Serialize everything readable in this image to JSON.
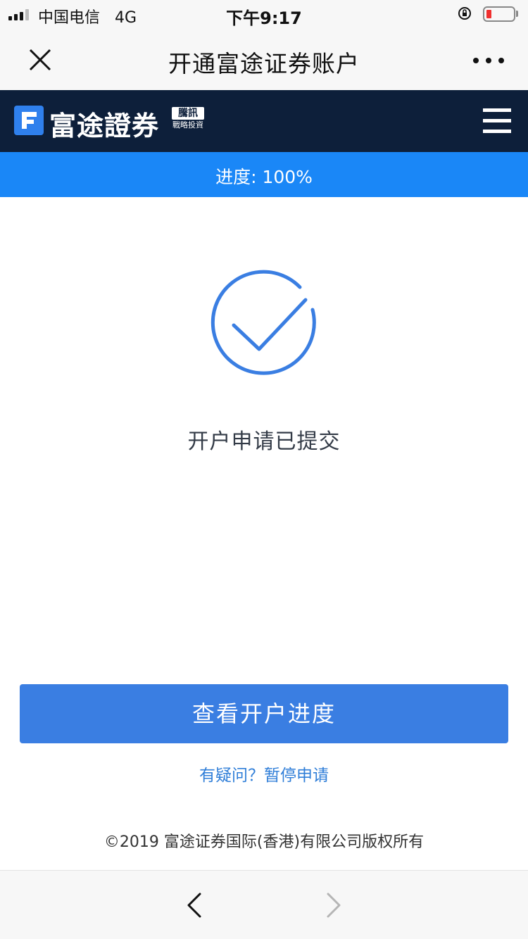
{
  "status_bar": {
    "carrier": "中国电信",
    "network": "4G",
    "time": "下午9:17",
    "battery_color": "#f0302f"
  },
  "nav": {
    "title": "开通富途证券账户",
    "close_icon": "close-icon",
    "more_icon": "more-icon"
  },
  "brand": {
    "name": "富途證券",
    "partner_tag": "騰訊",
    "partner_sub": "戰略投資",
    "logo_color": "#2f80ed",
    "background": "#0d1f3a"
  },
  "progress": {
    "label": "进度: 100%",
    "value": 1.0,
    "color": "#1a87f7"
  },
  "main": {
    "icon": "check-circle-icon",
    "message": "开户申请已提交",
    "primary_button": "查看开户进度",
    "help_link": "有疑问？暂停申请",
    "copyright": "©2019 富途证券国际(香港)有限公司版权所有",
    "accent": "#3a7ee2"
  },
  "toolbar": {
    "back_icon": "chevron-left-icon",
    "forward_icon": "chevron-right-icon"
  }
}
